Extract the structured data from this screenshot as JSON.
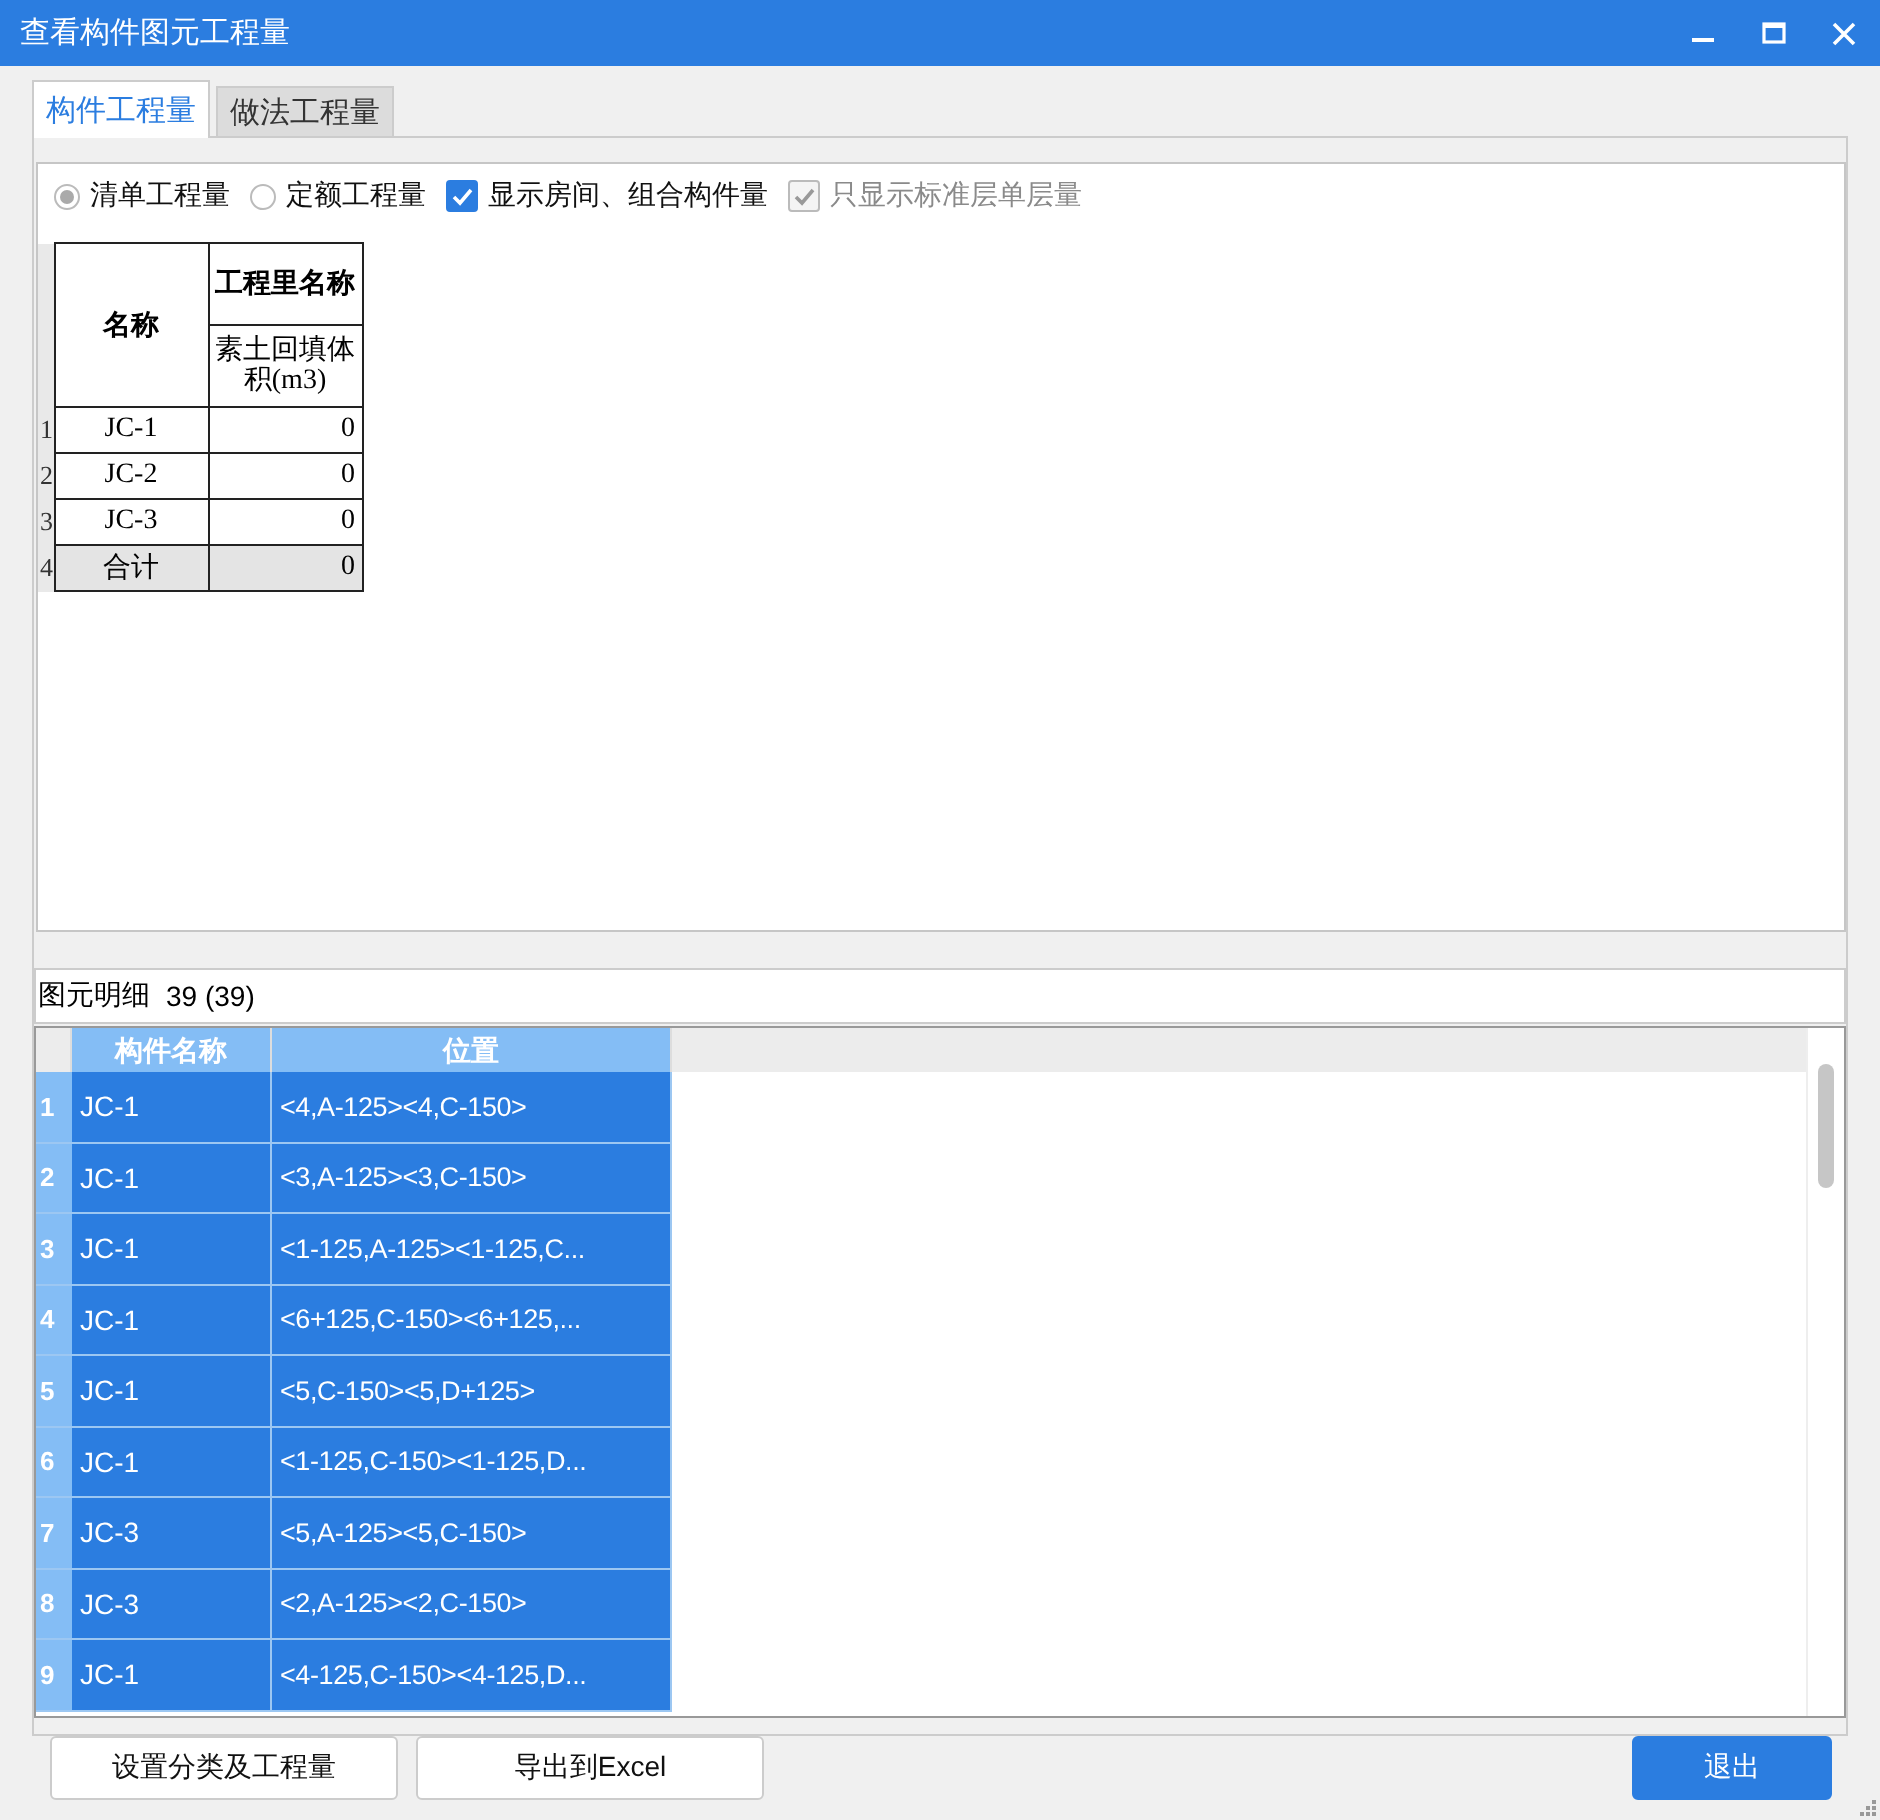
{
  "window": {
    "title": "查看构件图元工程量"
  },
  "tabs": [
    {
      "label": "构件工程量",
      "selected": true
    },
    {
      "label": "做法工程量",
      "selected": false
    }
  ],
  "options": [
    {
      "kind": "radio",
      "label": "清单工程量",
      "selected": true
    },
    {
      "kind": "radio",
      "label": "定额工程量",
      "selected": false
    },
    {
      "kind": "checkbox",
      "label": "显示房间、组合构件量",
      "checked": true,
      "disabled": false
    },
    {
      "kind": "checkbox",
      "label": "只显示标准层单层量",
      "checked": true,
      "disabled": true
    }
  ],
  "summary_table": {
    "name_header": "名称",
    "group_header": "工程里名称",
    "column_header": "素土回填体积(m3)",
    "rows": [
      {
        "number": "1",
        "name": "JC-1",
        "value": "0",
        "kind": "item"
      },
      {
        "number": "2",
        "name": "JC-2",
        "value": "0",
        "kind": "item"
      },
      {
        "number": "3",
        "name": "JC-3",
        "value": "0",
        "kind": "item"
      },
      {
        "number": "4",
        "name": "合计",
        "value": "0",
        "kind": "total"
      }
    ]
  },
  "detail": {
    "label": "图元明细",
    "count": "39 (39)",
    "columns": [
      "构件名称",
      "位置"
    ],
    "rows": [
      {
        "number": "1",
        "name": "JC-1",
        "position": "<4,A-125><4,C-150>",
        "selected": true
      },
      {
        "number": "2",
        "name": "JC-1",
        "position": "<3,A-125><3,C-150>",
        "selected": true
      },
      {
        "number": "3",
        "name": "JC-1",
        "position": "<1-125,A-125><1-125,C...",
        "selected": true
      },
      {
        "number": "4",
        "name": "JC-1",
        "position": "<6+125,C-150><6+125,...",
        "selected": true
      },
      {
        "number": "5",
        "name": "JC-1",
        "position": "<5,C-150><5,D+125>",
        "selected": true
      },
      {
        "number": "6",
        "name": "JC-1",
        "position": "<1-125,C-150><1-125,D...",
        "selected": true
      },
      {
        "number": "7",
        "name": "JC-3",
        "position": "<5,A-125><5,C-150>",
        "selected": true
      },
      {
        "number": "8",
        "name": "JC-3",
        "position": "<2,A-125><2,C-150>",
        "selected": true
      },
      {
        "number": "9",
        "name": "JC-1",
        "position": "<4-125,C-150><4-125,D...",
        "selected": true
      }
    ]
  },
  "buttons": [
    {
      "label": "设置分类及工程量",
      "primary": false
    },
    {
      "label": "导出到Excel",
      "primary": false
    },
    {
      "label": "退出",
      "primary": true
    }
  ]
}
